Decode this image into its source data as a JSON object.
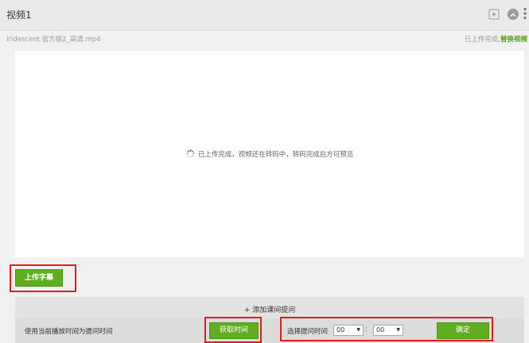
{
  "header": {
    "title": "视频1",
    "play_icon": "play-icon",
    "collapse_icon": "collapse-icon",
    "more_icon": "more-vertical-icon"
  },
  "file": {
    "name": "Iridescent 官方版2_高清.mp4",
    "status_text": "已上传完成,",
    "replace_link": "替换视频"
  },
  "preview": {
    "spinner_icon": "loading-spinner-icon",
    "message": "已上传完成，视频还在转码中，转码完成后方可预览"
  },
  "upload_subtitle_label": "上传字幕",
  "questions": {
    "add_label": "+ 添加课间提问",
    "use_current_label": "使用当前播放时间为提问时间",
    "get_time_label": "获取时间",
    "select_time_label": "选择提问时间",
    "hour_value": "00",
    "colon": ":",
    "minute_value": "00",
    "confirm_label": "确定"
  },
  "colors": {
    "accent_green": "#5fae1d",
    "highlight_red": "#e31b1b",
    "link_green": "#5a9e1a"
  }
}
